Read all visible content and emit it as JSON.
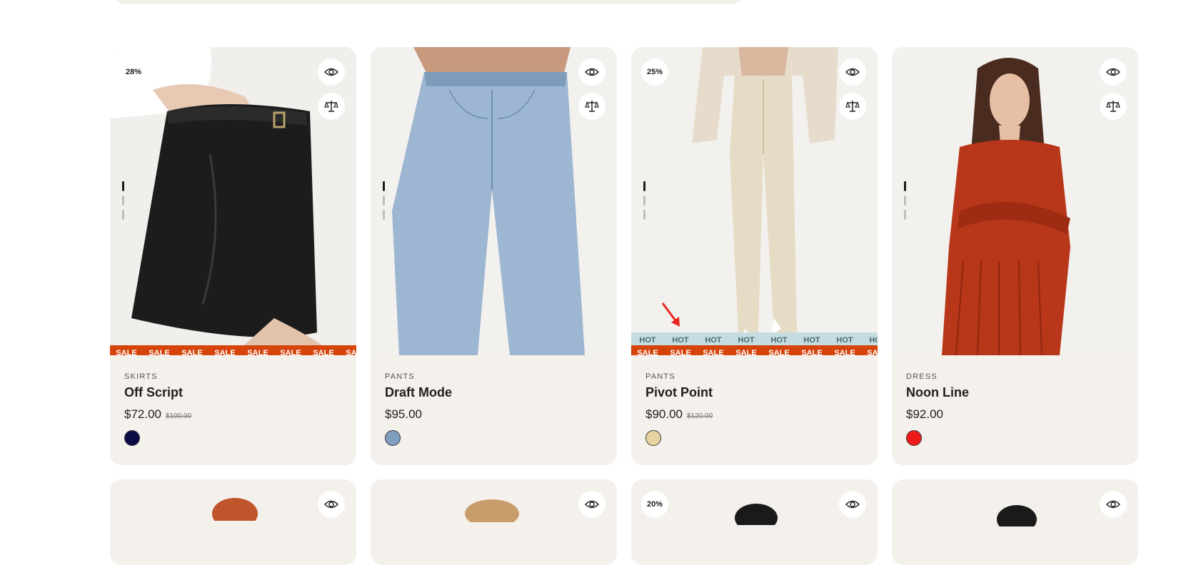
{
  "products": [
    {
      "discount": "28%",
      "category": "SKIRTS",
      "name": "Off Script",
      "price": "$72.00",
      "old_price": "$100.00",
      "swatch_color": "#0b0b45",
      "ribbon": "SALE",
      "hot": false
    },
    {
      "discount": "",
      "category": "PANTS",
      "name": "Draft Mode",
      "price": "$95.00",
      "old_price": "",
      "swatch_color": "#7f9ec0",
      "ribbon": "",
      "hot": false
    },
    {
      "discount": "25%",
      "category": "PANTS",
      "name": "Pivot Point",
      "price": "$90.00",
      "old_price": "$120.00",
      "swatch_color": "#e6d3a0",
      "ribbon": "SALE",
      "hot": true,
      "hot_label": "HOT"
    },
    {
      "discount": "",
      "category": "DRESS",
      "name": "Noon Line",
      "price": "$92.00",
      "old_price": "",
      "swatch_color": "#ef1b1b",
      "ribbon": "",
      "hot": false
    }
  ],
  "next_row": [
    {
      "discount": ""
    },
    {
      "discount": ""
    },
    {
      "discount": "20%"
    },
    {
      "discount": ""
    }
  ],
  "icons": {
    "quick_view": "eye-icon",
    "compare": "scale-icon"
  },
  "colors": {
    "card_bg": "#f4f1ec",
    "sale_ribbon": "#d5440b",
    "hot_ribbon": "#c5dde1",
    "annotation_arrow": "#e8251f"
  }
}
